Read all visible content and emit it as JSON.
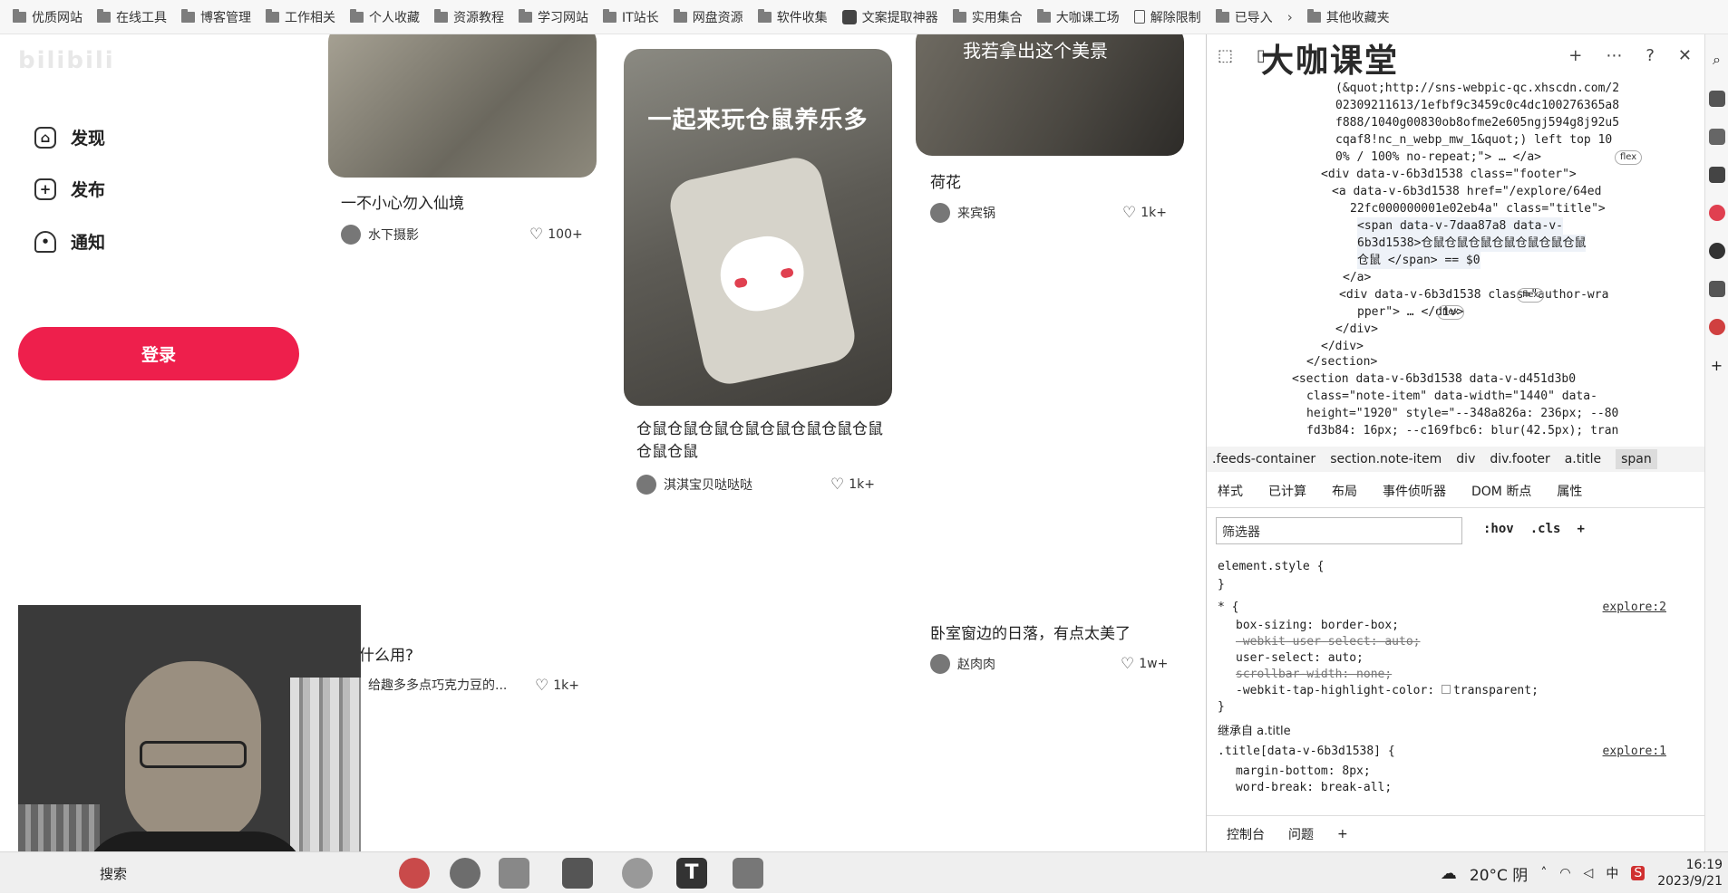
{
  "bookmarks": [
    {
      "label": "优质网站",
      "icon": "folder-icon"
    },
    {
      "label": "在线工具",
      "icon": "folder-icon"
    },
    {
      "label": "博客管理",
      "icon": "folder-icon"
    },
    {
      "label": "工作相关",
      "icon": "folder-icon"
    },
    {
      "label": "个人收藏",
      "icon": "folder-icon"
    },
    {
      "label": "资源教程",
      "icon": "folder-icon"
    },
    {
      "label": "学习网站",
      "icon": "folder-icon"
    },
    {
      "label": "IT站长",
      "icon": "folder-icon"
    },
    {
      "label": "网盘资源",
      "icon": "folder-icon"
    },
    {
      "label": "软件收集",
      "icon": "folder-icon"
    },
    {
      "label": "文案提取神器",
      "icon": "app-icon"
    },
    {
      "label": "实用集合",
      "icon": "folder-icon"
    },
    {
      "label": "大咖课工场",
      "icon": "folder-icon"
    },
    {
      "label": "解除限制",
      "icon": "page-icon"
    },
    {
      "label": "已导入",
      "icon": "folder-icon"
    }
  ],
  "bookmarks_more": "其他收藏夹",
  "sidebar": {
    "logo": "bilibili",
    "items": [
      {
        "label": "发现",
        "icon": "home-icon"
      },
      {
        "label": "发布",
        "icon": "plus-icon"
      },
      {
        "label": "通知",
        "icon": "bell-icon"
      }
    ],
    "login": "登录"
  },
  "feed": [
    {
      "title": "一不小心勿入仙境",
      "author": "水下摄影",
      "likes": "100+"
    },
    {
      "title": "仓鼠仓鼠仓鼠仓鼠仓鼠仓鼠仓鼠仓鼠仓鼠仓鼠",
      "author": "淇淇宝贝哒哒哒",
      "likes": "1k+",
      "image_text": "一起来玩仓鼠养乐多"
    },
    {
      "title": "荷花",
      "author": "来宾锅",
      "likes": "1k+",
      "image_text": "我若拿出这个美景"
    },
    {
      "title": "什么用?",
      "author": "给趣多多点巧克力豆的...",
      "likes": "1k+"
    },
    {
      "title": "卧室窗边的日落，有点太美了",
      "author": "赵肉肉",
      "likes": "1w+"
    }
  ],
  "devtools": {
    "watermark": "大咖课堂",
    "html": [
      "(&quot;http://sns-webpic-qc.xhscdn.com/2",
      "02309211613/1efbf9c3459c0c4dc100276365a8",
      "f888/1040g00830ob8ofme2e605ngj594g8j92u5",
      "cqaf8!nc_n_webp_mw_1&quot;) left top 10",
      "0% / 100% no-repeat;\"> … </a>",
      "<div data-v-6b3d1538 class=\"footer\">",
      "<a data-v-6b3d1538 href=\"/explore/64ed",
      "22fc000000001e02eb4a\" class=\"title\">",
      "<span data-v-7daa87a8 data-v-",
      "6b3d1538>仓鼠仓鼠仓鼠仓鼠仓鼠仓鼠仓鼠",
      "仓鼠 </span> == $0",
      "</a>",
      "<div data-v-6b3d1538 class=\"author-wra",
      "pper\"> … </div>",
      "</div>",
      "</div>",
      "</section>",
      "<section data-v-6b3d1538 data-v-d451d3b0",
      "class=\"note-item\" data-width=\"1440\" data-",
      "height=\"1920\" style=\"--348a826a: 236px; --80",
      "fd3b84: 16px; --c169fbc6: blur(42.5px); tran"
    ],
    "pill": "flex",
    "crumbs": [
      ".feeds-container",
      "section.note-item",
      "div",
      "div.footer",
      "a.title",
      "span"
    ],
    "style_tabs": [
      "样式",
      "已计算",
      "布局",
      "事件侦听器",
      "DOM 断点",
      "属性"
    ],
    "filter_placeholder": "筛选器",
    "filter_tools": [
      ":hov",
      ".cls"
    ],
    "css": [
      "element.style {",
      "}",
      "* {",
      "explore:2",
      "box-sizing: border-box;",
      "-webkit-user-select: auto;",
      "user-select: auto;",
      "scrollbar-width: none;",
      "-webkit-tap-highlight-color: ",
      "transparent;",
      "}",
      "继承自 ",
      "a.title",
      ".title[data-v-6b3d1538] {",
      "explore:1",
      "margin-bottom: 8px;",
      "word-break: break-all;"
    ],
    "console_tabs": [
      "控制台",
      "问题"
    ]
  },
  "taskbar": {
    "search": "搜索",
    "weather": "20°C  阴",
    "ime": "中",
    "time": "16:19",
    "date": "2023/9/21"
  }
}
